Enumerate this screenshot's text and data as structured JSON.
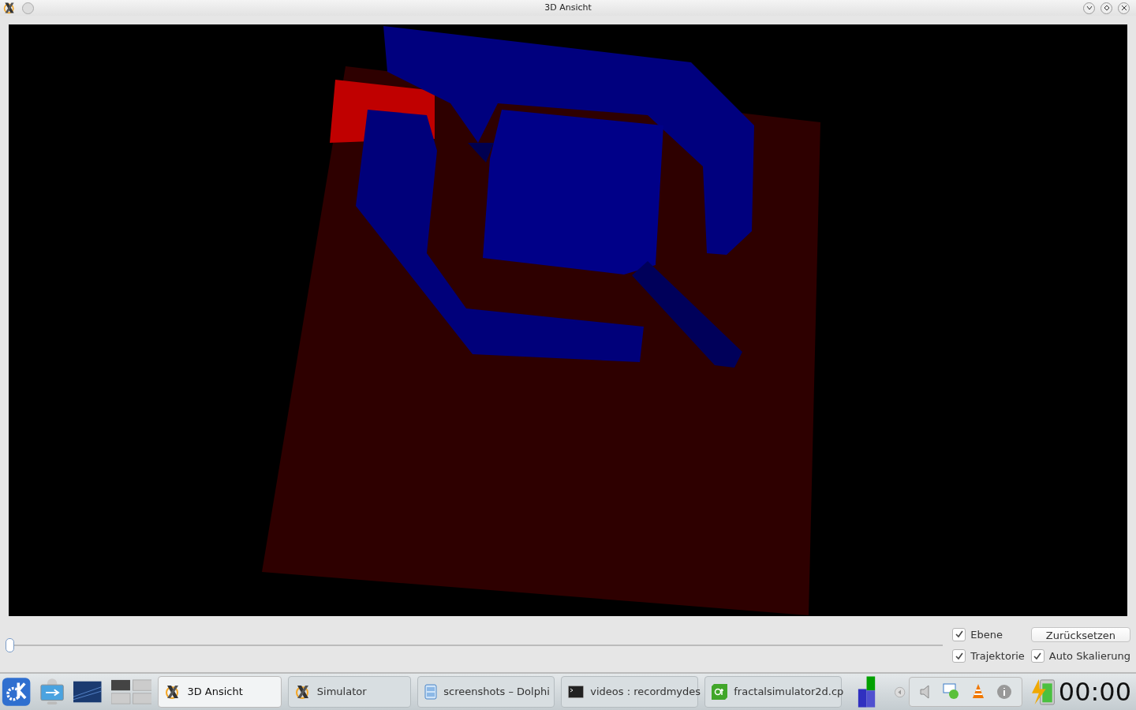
{
  "window": {
    "title": "3D Ansicht"
  },
  "slider": {
    "level": 0
  },
  "options": [
    {
      "label": "Ebene",
      "checked": true
    },
    {
      "label": "Trajektorie",
      "checked": true
    },
    {
      "label": "Auto Skalierung",
      "checked": true
    }
  ],
  "reset_button": "Zurücksetzen",
  "taskbar": {
    "tasks": [
      {
        "label": "3D Ansicht",
        "kind": "x",
        "selected": true
      },
      {
        "label": "Simulator",
        "kind": "x",
        "selected": false
      },
      {
        "label": "screenshots – Dolphi",
        "kind": "folder",
        "selected": false
      },
      {
        "label": "videos : recordmydes",
        "kind": "terminal",
        "selected": false
      },
      {
        "label": "fractalsimulator2d.cp",
        "kind": "qt",
        "selected": false
      }
    ],
    "clock": "00:00"
  }
}
